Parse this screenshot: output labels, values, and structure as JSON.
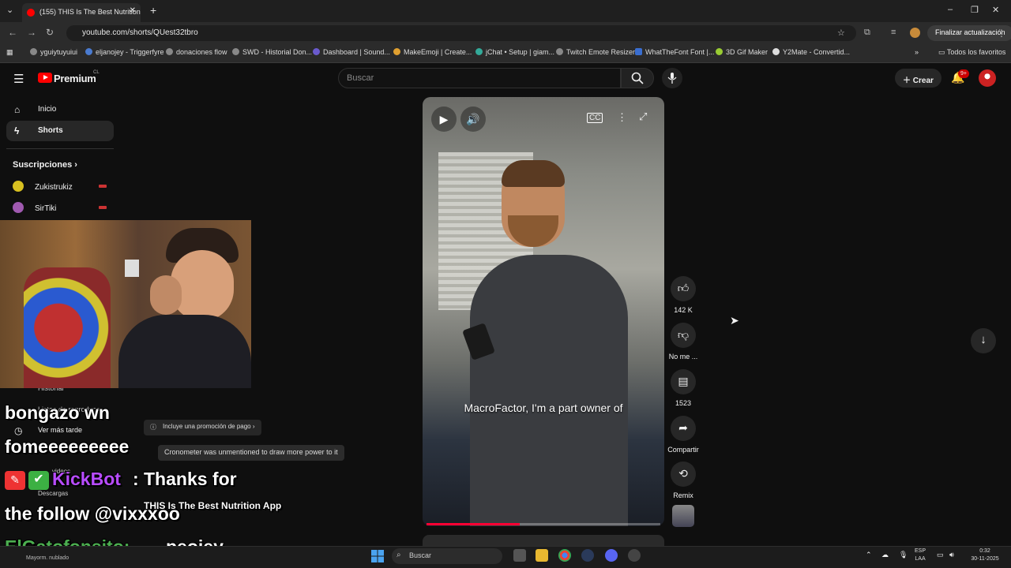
{
  "browser": {
    "tab_title": "(155) THIS Is The Best Nutrition",
    "url": "youtube.com/shorts/QUest32tbro",
    "update_label": "Finalizar actualización",
    "bookmarks": [
      "yguiytuyuiui",
      "eljanojey - Triggerfyre",
      "donaciones flow",
      "SWD - Historial Don...",
      "Dashboard | Sound...",
      "MakeEmoji | Create...",
      "jChat • Setup | giam...",
      "Twitch Emote Resizer",
      "WhatTheFont Font |...",
      "3D Gif Maker",
      "Y2Mate - Convertid..."
    ],
    "all_bookmarks": "Todos los favoritos"
  },
  "youtube": {
    "logo_text": "Premium",
    "logo_region": "CL",
    "search_placeholder": "Buscar",
    "create_label": "Crear",
    "notif_count": "9+",
    "sidebar": {
      "home": "Inicio",
      "shorts": "Shorts",
      "subs_heading": "Suscripciones",
      "subs": [
        "Zukistrukiz",
        "SirTiki"
      ],
      "history": "Historial",
      "playlists": "Listas de reproducc...",
      "watch_later": "Ver más tarde",
      "videos": "videos",
      "downloads": "Descargas"
    },
    "video": {
      "caption": "MacroFactor, I'm a part owner of",
      "progress": 0.4,
      "title": "THIS Is The Best Nutrition App",
      "promo": "Incluye una promoción de pago",
      "tooltip": "Cronometer was unmentioned to draw more power to it"
    },
    "actions": {
      "likes": "142 K",
      "dislike": "No me ...",
      "comments": "1523",
      "share": "Compartir",
      "remix": "Remix"
    }
  },
  "stream_chat": {
    "line1": "bongazo wn",
    "line2": "fomeeeeeeeee",
    "bot_name": "KickBot",
    "bot_msg": "Thanks for",
    "line4": "the follow @vixxxoo",
    "user": "ElGatofonsito:",
    "user_msg": "peojey"
  },
  "taskbar": {
    "search": "Buscar",
    "weather": "Mayorm. nublado",
    "lang1": "ESP",
    "lang2": "LAA",
    "time": "0:32",
    "date": "30-11-2025"
  },
  "colors": {
    "accent": "#ff0000",
    "bg": "#0f0f0f",
    "chat_green": "#4caf50",
    "kickbot": "#b84cff"
  }
}
